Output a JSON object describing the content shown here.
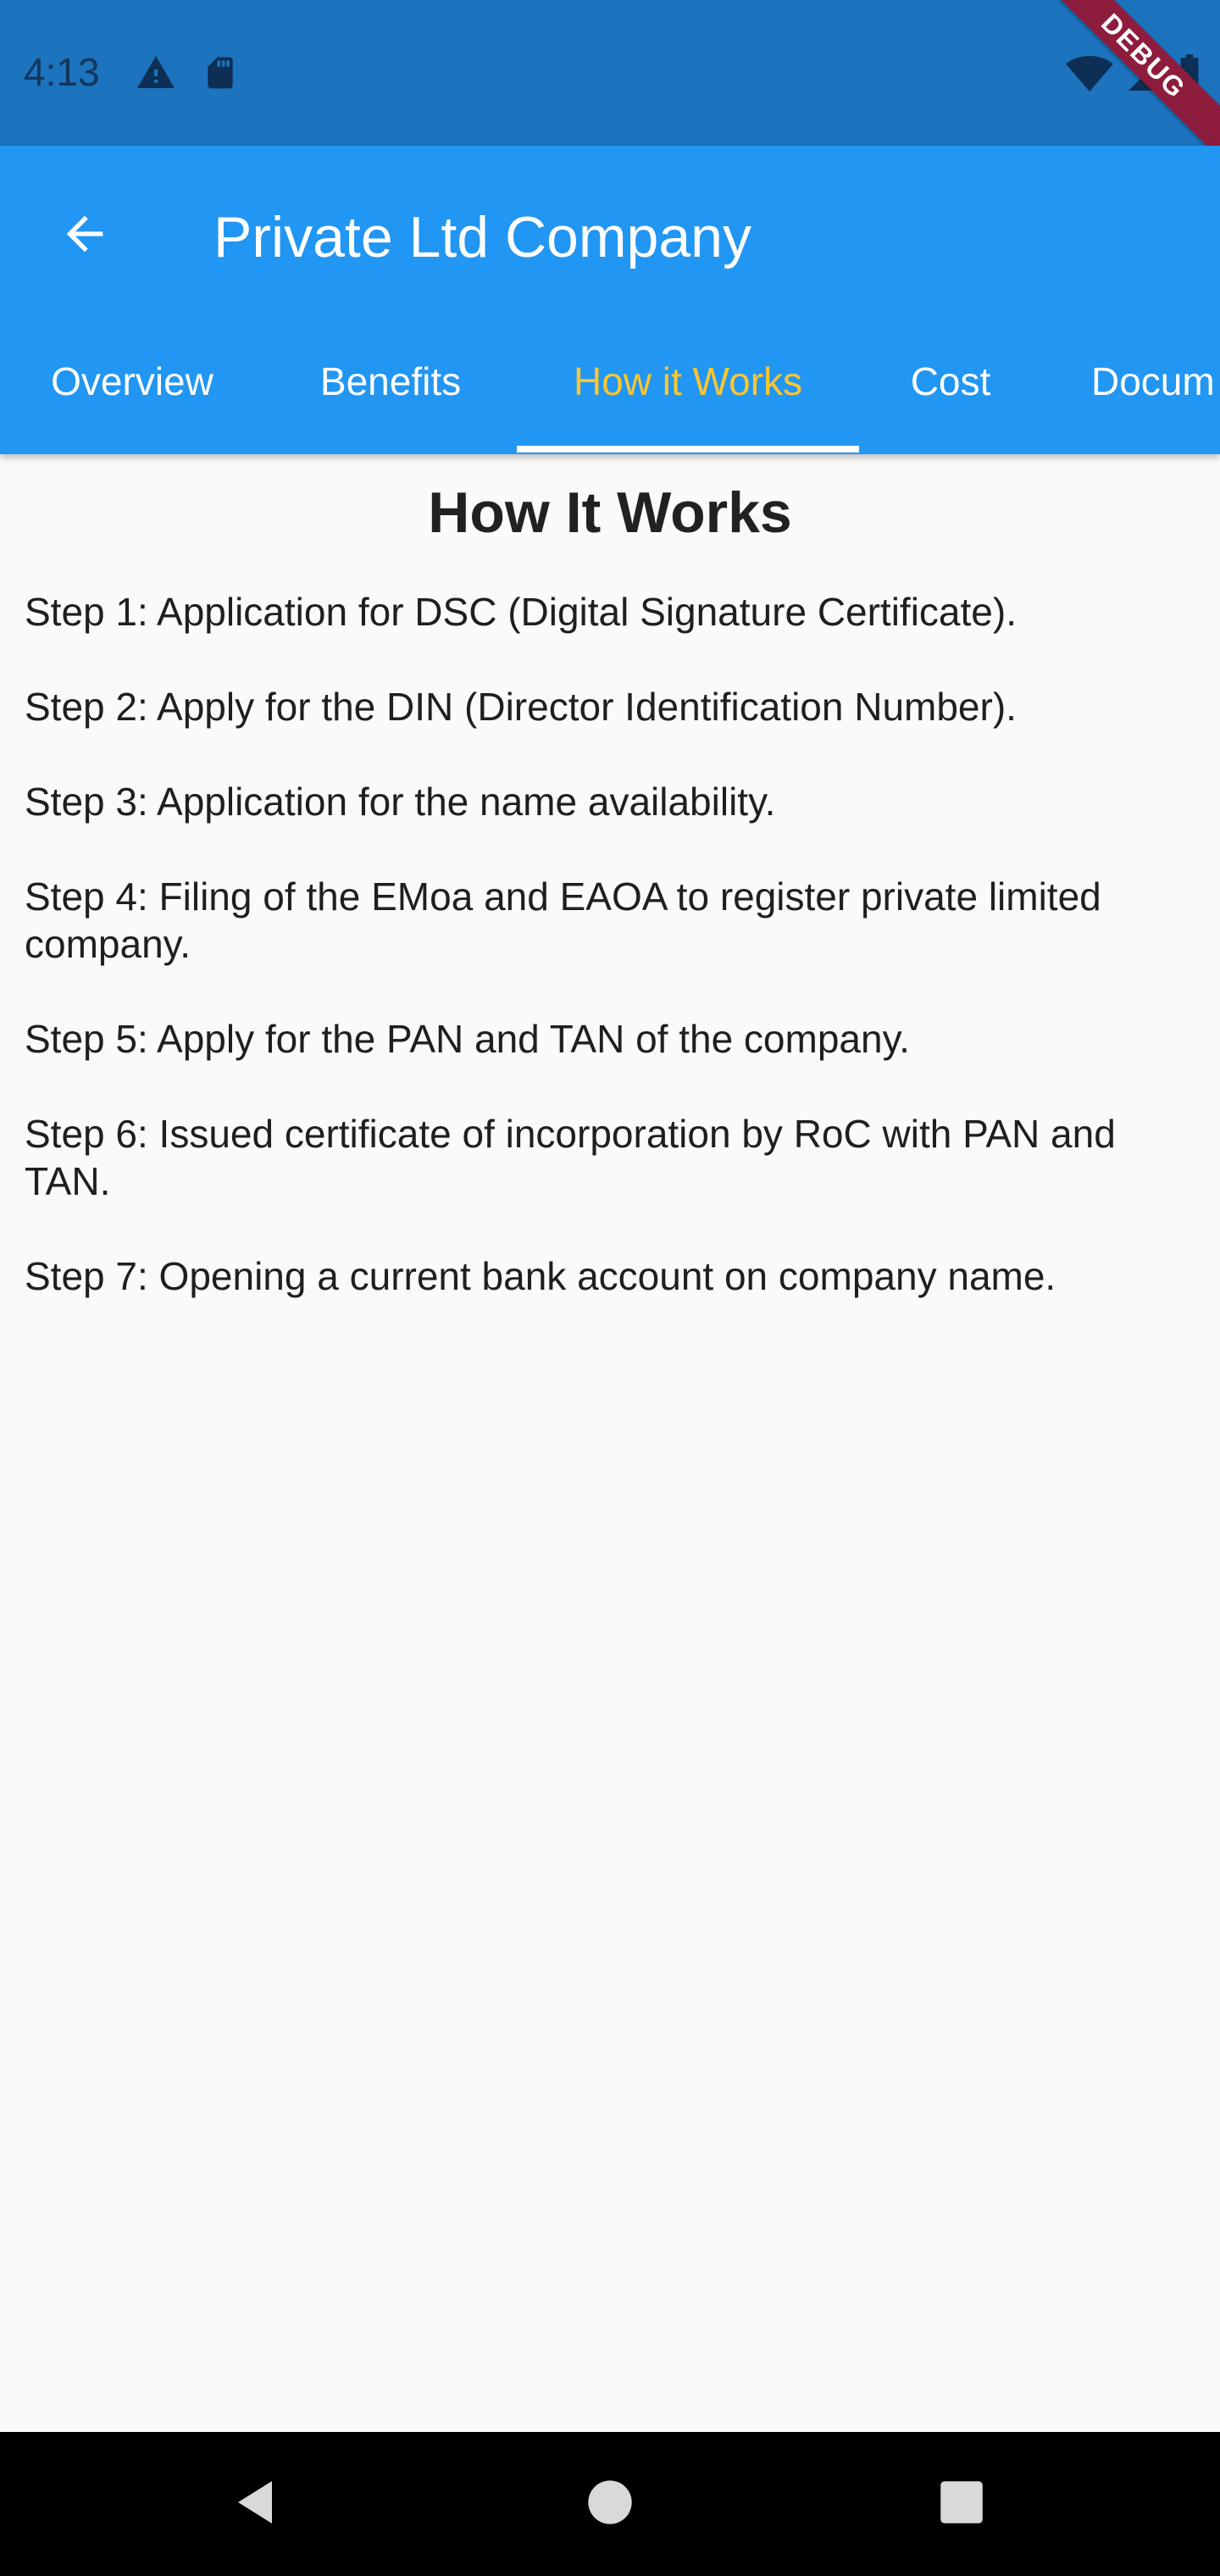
{
  "status_bar": {
    "time": "4:13",
    "icons_left": [
      "warning-icon",
      "sd-card-icon"
    ],
    "icons_right": [
      "wifi-icon",
      "signal-icon",
      "battery-icon"
    ],
    "debug_banner": "DEBUG",
    "background": "#1C73BE"
  },
  "app_bar": {
    "title": "Private Ltd Company",
    "back_icon": "arrow-back-icon",
    "background": "#2196F3"
  },
  "tabs": [
    {
      "label": "Overview",
      "active": false
    },
    {
      "label": "Benefits",
      "active": false
    },
    {
      "label": "How it Works",
      "active": true
    },
    {
      "label": "Cost",
      "active": false
    },
    {
      "label": "Docum",
      "active": false
    }
  ],
  "colors": {
    "active_tab_text": "#F9C630",
    "tab_indicator": "#FFFFFF"
  },
  "content": {
    "heading": "How It Works",
    "steps": [
      "Step 1: Application for DSC (Digital Signature Certificate).",
      "Step 2: Apply for the DIN (Director Identification Number).",
      "Step 3: Application for the name availability.",
      "Step 4: Filing of the EMoa and EAOA to register private limited company.",
      "Step 5: Apply for the PAN and TAN of the company.",
      "Step 6: Issued certificate of incorporation by RoC with PAN and TAN.",
      "Step 7: Opening a current bank account on company name."
    ]
  },
  "nav_bar": {
    "buttons": [
      "back-triangle-icon",
      "home-circle-icon",
      "recents-square-icon"
    ]
  }
}
